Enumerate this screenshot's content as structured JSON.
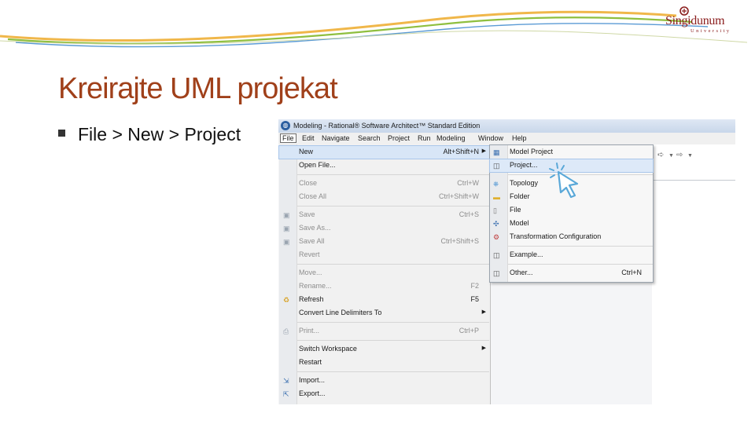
{
  "slide": {
    "title": "Kreirajte UML projekat",
    "bullet": "File > New > Project"
  },
  "logo": {
    "name": "Singidunum",
    "sub": "University"
  },
  "window": {
    "title": "Modeling - Rational® Software Architect™ Standard Edition",
    "app_icon": "eclipse-icon"
  },
  "menubar": [
    "File",
    "Edit",
    "Navigate",
    "Search",
    "Project",
    "Run",
    "Modeling",
    "Window",
    "Help"
  ],
  "file_menu": [
    {
      "label": "New",
      "shortcut": "Alt+Shift+N",
      "submenu": true,
      "state": "highlighted"
    },
    {
      "label": "Open File...",
      "shortcut": "",
      "state": "enabled"
    },
    {
      "label": "Close",
      "shortcut": "Ctrl+W",
      "state": "disabled"
    },
    {
      "label": "Close All",
      "shortcut": "Ctrl+Shift+W",
      "state": "disabled"
    },
    {
      "label": "Save",
      "shortcut": "Ctrl+S",
      "state": "disabled",
      "icon": "save-icon"
    },
    {
      "label": "Save As...",
      "shortcut": "",
      "state": "disabled",
      "icon": "save-as-icon"
    },
    {
      "label": "Save All",
      "shortcut": "Ctrl+Shift+S",
      "state": "disabled",
      "icon": "save-all-icon"
    },
    {
      "label": "Revert",
      "shortcut": "",
      "state": "disabled"
    },
    {
      "label": "Move...",
      "shortcut": "",
      "state": "disabled"
    },
    {
      "label": "Rename...",
      "shortcut": "F2",
      "state": "disabled"
    },
    {
      "label": "Refresh",
      "shortcut": "F5",
      "state": "enabled",
      "icon": "refresh-icon"
    },
    {
      "label": "Convert Line Delimiters To",
      "shortcut": "",
      "submenu": true,
      "state": "enabled"
    },
    {
      "label": "Print...",
      "shortcut": "Ctrl+P",
      "state": "disabled",
      "icon": "print-icon"
    },
    {
      "label": "Switch Workspace",
      "shortcut": "",
      "submenu": true,
      "state": "enabled"
    },
    {
      "label": "Restart",
      "shortcut": "",
      "state": "enabled"
    },
    {
      "label": "Import...",
      "shortcut": "",
      "state": "enabled",
      "icon": "import-icon"
    },
    {
      "label": "Export...",
      "shortcut": "",
      "state": "enabled",
      "icon": "export-icon"
    }
  ],
  "new_menu": [
    {
      "label": "Model Project",
      "shortcut": "",
      "icon": "model-project-icon"
    },
    {
      "label": "Project...",
      "shortcut": "",
      "icon": "project-icon",
      "state": "highlighted"
    },
    {
      "label": "Topology",
      "shortcut": "",
      "icon": "topology-icon"
    },
    {
      "label": "Folder",
      "shortcut": "",
      "icon": "folder-icon"
    },
    {
      "label": "File",
      "shortcut": "",
      "icon": "file-icon"
    },
    {
      "label": "Model",
      "shortcut": "",
      "icon": "model-icon"
    },
    {
      "label": "Transformation Configuration",
      "shortcut": "",
      "icon": "transformation-icon"
    },
    {
      "label": "Example...",
      "shortcut": "",
      "icon": "example-icon"
    },
    {
      "label": "Other...",
      "shortcut": "Ctrl+N",
      "icon": "other-icon"
    }
  ],
  "colors": {
    "title": "#a0401a",
    "highlight": "#d8e6f7",
    "cursor": "#5aa8d8"
  }
}
